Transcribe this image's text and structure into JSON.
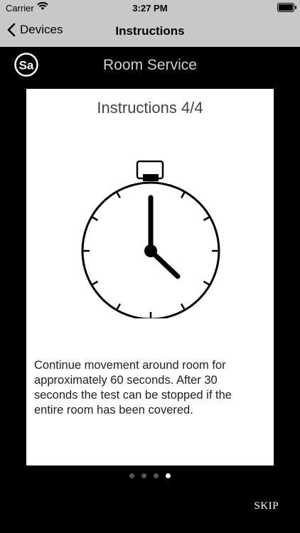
{
  "status_bar": {
    "carrier": "Carrier",
    "time": "3:27 PM"
  },
  "nav": {
    "back_label": "Devices",
    "title": "Instructions"
  },
  "header": {
    "logo_text": "Sa",
    "title": "Room Service"
  },
  "card": {
    "title": "Instructions 4/4",
    "text": "Continue movement around room for approximately 60 seconds. After 30 seconds the test can be stopped if the entire room has been covered."
  },
  "pager": {
    "total": 4,
    "current": 4
  },
  "skip_label": "SKIP",
  "icons": [
    "wifi-icon",
    "battery-icon",
    "back-chevron-icon",
    "logo-icon",
    "stopwatch-icon"
  ],
  "colors": {
    "nav_background": "#c8c8c8",
    "background": "#000000",
    "card": "#ffffff",
    "active_dot": "#ffffff",
    "inactive_dot": "#555555"
  }
}
